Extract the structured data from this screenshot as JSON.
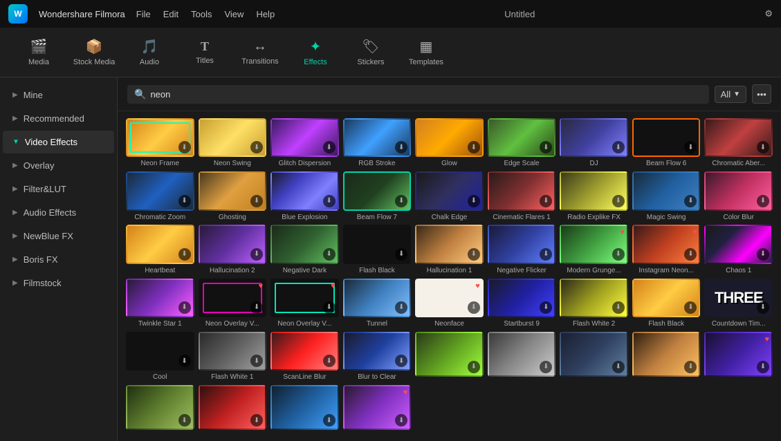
{
  "app": {
    "name": "Wondershare Filmora",
    "title": "Untitled"
  },
  "menu": {
    "items": [
      "File",
      "Edit",
      "Tools",
      "View",
      "Help"
    ]
  },
  "toolbar": {
    "items": [
      {
        "id": "media",
        "label": "Media",
        "icon": "🎬"
      },
      {
        "id": "stock",
        "label": "Stock Media",
        "icon": "📦"
      },
      {
        "id": "audio",
        "label": "Audio",
        "icon": "🎵"
      },
      {
        "id": "titles",
        "label": "Titles",
        "icon": "T"
      },
      {
        "id": "transitions",
        "label": "Transitions",
        "icon": "↔"
      },
      {
        "id": "effects",
        "label": "Effects",
        "icon": "✦",
        "active": true
      },
      {
        "id": "stickers",
        "label": "Stickers",
        "icon": "😊"
      },
      {
        "id": "templates",
        "label": "Templates",
        "icon": "▦"
      }
    ]
  },
  "sidebar": {
    "items": [
      {
        "id": "mine",
        "label": "Mine",
        "active": false
      },
      {
        "id": "recommended",
        "label": "Recommended",
        "active": false
      },
      {
        "id": "video-effects",
        "label": "Video Effects",
        "active": true
      },
      {
        "id": "overlay",
        "label": "Overlay",
        "active": false
      },
      {
        "id": "filter-lut",
        "label": "Filter&LUT",
        "active": false
      },
      {
        "id": "audio-effects",
        "label": "Audio Effects",
        "active": false
      },
      {
        "id": "newblue-fx",
        "label": "NewBlue FX",
        "active": false
      },
      {
        "id": "boris-fx",
        "label": "Boris FX",
        "active": false
      },
      {
        "id": "filmstock",
        "label": "Filmstock",
        "active": false
      }
    ]
  },
  "search": {
    "placeholder": "Search",
    "value": "neon",
    "filter": "All"
  },
  "effects": [
    {
      "id": "neon-frame",
      "name": "Neon Frame",
      "thumb": "t1",
      "hasDownload": true
    },
    {
      "id": "neon-swing",
      "name": "Neon Swing",
      "thumb": "t2",
      "hasDownload": true
    },
    {
      "id": "glitch-dispersion",
      "name": "Glitch Dispersion",
      "thumb": "t3",
      "hasDownload": true
    },
    {
      "id": "rgb-stroke",
      "name": "RGB Stroke",
      "thumb": "t4",
      "hasDownload": true
    },
    {
      "id": "glow",
      "name": "Glow",
      "thumb": "t5",
      "hasDownload": true
    },
    {
      "id": "edge-scale",
      "name": "Edge Scale",
      "thumb": "t6",
      "hasDownload": true
    },
    {
      "id": "dj",
      "name": "DJ",
      "thumb": "t7",
      "hasDownload": true
    },
    {
      "id": "beam-flow-6",
      "name": "Beam Flow 6",
      "thumb": "t9",
      "hasDownload": true,
      "highlight": true
    },
    {
      "id": "chromatic-aber",
      "name": "Chromatic Aber...",
      "thumb": "t10",
      "hasDownload": true
    },
    {
      "id": "chromatic-zoom",
      "name": "Chromatic Zoom",
      "thumb": "t11",
      "hasDownload": true
    },
    {
      "id": "ghosting",
      "name": "Ghosting",
      "thumb": "t12",
      "hasDownload": true
    },
    {
      "id": "blue-explosion",
      "name": "Blue Explosion",
      "thumb": "t13",
      "hasDownload": true
    },
    {
      "id": "beam-flow-7",
      "name": "Beam Flow 7",
      "thumb": "t14",
      "hasDownload": true,
      "cyan": true
    },
    {
      "id": "chalk-edge",
      "name": "Chalk Edge",
      "thumb": "t15",
      "hasDownload": true
    },
    {
      "id": "cinematic-flares-1",
      "name": "Cinematic Flares 1",
      "thumb": "t16",
      "hasDownload": true
    },
    {
      "id": "radio-explike-fx",
      "name": "Radio Explike FX",
      "thumb": "t17",
      "hasDownload": true
    },
    {
      "id": "magic-swing",
      "name": "Magic Swing",
      "thumb": "t18",
      "hasDownload": true
    },
    {
      "id": "color-blur",
      "name": "Color Blur",
      "thumb": "t19",
      "hasDownload": true
    },
    {
      "id": "heartbeat",
      "name": "Heartbeat",
      "thumb": "t20",
      "hasDownload": true
    },
    {
      "id": "hallucination-2",
      "name": "Hallucination 2",
      "thumb": "t21",
      "hasDownload": true
    },
    {
      "id": "negative-dark",
      "name": "Negative Dark",
      "thumb": "t22",
      "hasDownload": true
    },
    {
      "id": "flash-black",
      "name": "Flash Black",
      "thumb": "t37",
      "hasDownload": true
    },
    {
      "id": "hallucination-1",
      "name": "Hallucination 1",
      "thumb": "t23",
      "hasDownload": true
    },
    {
      "id": "negative-flicker",
      "name": "Negative Flicker",
      "thumb": "t24",
      "hasDownload": true
    },
    {
      "id": "modern-grunge",
      "name": "Modern Grunge...",
      "thumb": "t25",
      "hasDownload": true,
      "hasHeart": true
    },
    {
      "id": "instagram-neon",
      "name": "Instagram Neon...",
      "thumb": "t26",
      "hasDownload": true,
      "hasHeart": true
    },
    {
      "id": "chaos-1",
      "name": "Chaos 1",
      "thumb": "t27",
      "hasDownload": true
    },
    {
      "id": "twinkle-star-1",
      "name": "Twinkle Star 1",
      "thumb": "t28",
      "hasDownload": true
    },
    {
      "id": "neon-overlay-v1",
      "name": "Neon Overlay V...",
      "thumb": "t29",
      "hasDownload": true,
      "hasHeart": true
    },
    {
      "id": "neon-overlay-v2",
      "name": "Neon Overlay V...",
      "thumb": "t30",
      "hasDownload": true,
      "hasHeart": true
    },
    {
      "id": "tunnel",
      "name": "Tunnel",
      "thumb": "t31",
      "hasDownload": true
    },
    {
      "id": "neonface",
      "name": "Neonface",
      "thumb": "t32",
      "hasDownload": true,
      "hasHeart": true
    },
    {
      "id": "startburst-9",
      "name": "Startburst 9",
      "thumb": "t33",
      "hasDownload": true
    },
    {
      "id": "flash-white-2",
      "name": "Flash White 2",
      "thumb": "t34",
      "hasDownload": true
    },
    {
      "id": "flash-black-2",
      "name": "Flash Black",
      "thumb": "t35",
      "hasDownload": true
    },
    {
      "id": "countdown-time",
      "name": "Countdown Tim...",
      "thumb": "t36",
      "hasDownload": true,
      "countdown": true
    },
    {
      "id": "cool",
      "name": "Cool",
      "thumb": "t40",
      "hasDownload": true
    },
    {
      "id": "flash-white-1",
      "name": "Flash White 1",
      "thumb": "t41",
      "hasDownload": true
    },
    {
      "id": "scanline-blur",
      "name": "ScanLine Blur",
      "thumb": "t42",
      "hasDownload": true
    },
    {
      "id": "blur-to-clear",
      "name": "Blur to Clear",
      "thumb": "t43",
      "hasDownload": true
    },
    {
      "id": "r1",
      "name": "",
      "thumb": "t44",
      "hasDownload": true
    },
    {
      "id": "r2",
      "name": "",
      "thumb": "t45",
      "hasDownload": true
    },
    {
      "id": "r3",
      "name": "",
      "thumb": "t46",
      "hasDownload": true
    },
    {
      "id": "r4",
      "name": "",
      "thumb": "t47",
      "hasDownload": true
    },
    {
      "id": "r5",
      "name": "",
      "thumb": "t48",
      "hasDownload": true
    },
    {
      "id": "r6",
      "name": "",
      "thumb": "t49",
      "hasDownload": true
    },
    {
      "id": "r7",
      "name": "",
      "thumb": "t50",
      "hasDownload": true
    },
    {
      "id": "r8",
      "name": "",
      "thumb": "t51",
      "hasDownload": true
    },
    {
      "id": "r9",
      "name": "",
      "thumb": "t52",
      "hasDownload": true
    }
  ]
}
